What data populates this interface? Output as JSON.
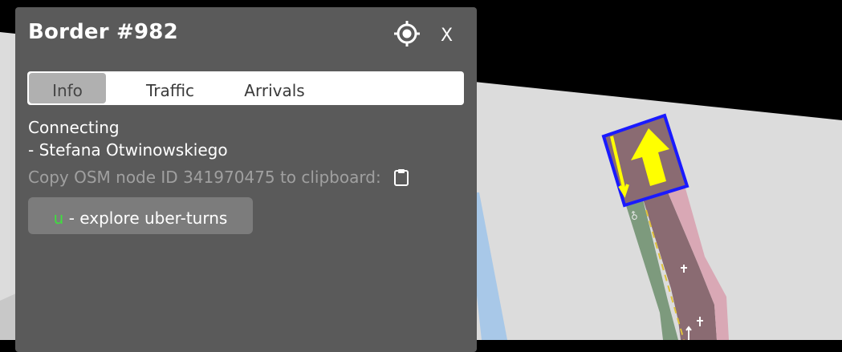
{
  "panel": {
    "title": "Border #982",
    "close_label": "X",
    "tabs": [
      {
        "label": "Info",
        "active": true
      },
      {
        "label": "Traffic",
        "active": false
      },
      {
        "label": "Arrivals",
        "active": false
      }
    ],
    "connecting_label": "Connecting",
    "connecting_road": "- Stefana Otwinowskiego",
    "copy_text": "Copy OSM node ID 341970475 to clipboard:",
    "uber_hotkey": "u",
    "uber_label": " - explore uber-turns"
  },
  "icons": {
    "locate": "crosshair-target-icon",
    "copy": "clipboard-icon"
  },
  "colors": {
    "panel_bg": "#5a5a5a",
    "hotkey": "#3ee03e",
    "highlight_border": "#1a1aff",
    "arrow": "#ffff00"
  }
}
